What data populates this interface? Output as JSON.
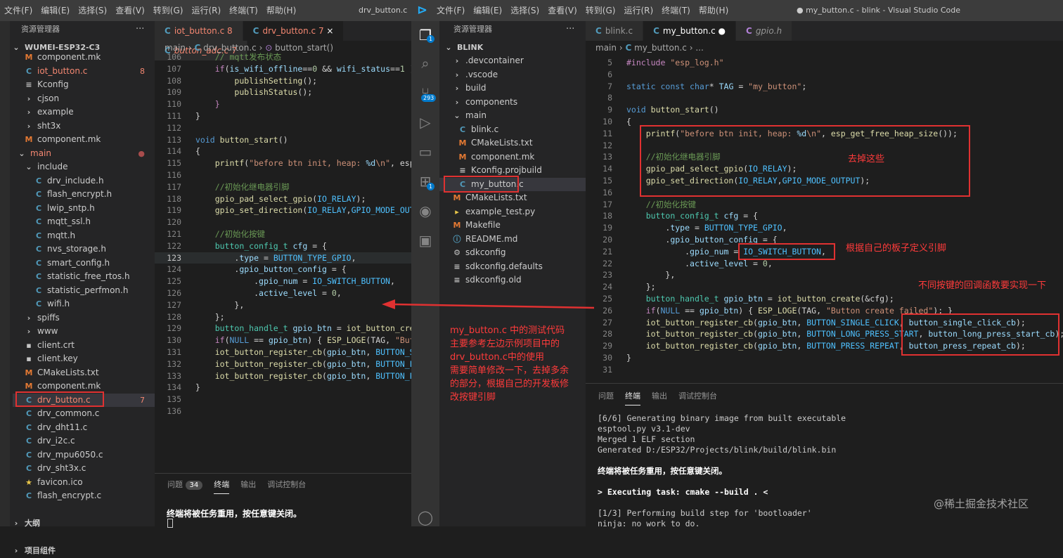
{
  "colors": {
    "accent": "#007acc",
    "annotation": "#ff3b3b",
    "c_icon": "#519aba",
    "m_icon": "#e37933",
    "error": "#f48771"
  },
  "left": {
    "menu": [
      "文件(F)",
      "编辑(E)",
      "选择(S)",
      "查看(V)",
      "转到(G)",
      "运行(R)",
      "终端(T)",
      "帮助(H)"
    ],
    "window_title": "drv_button.c - v",
    "explorer_title": "资源管理器",
    "dots": "···",
    "root": "WUMEI-ESP32-C3",
    "tree": [
      {
        "icon": "M",
        "label": "component.mk",
        "badge": ""
      },
      {
        "icon": "C",
        "label": "iot_button.c",
        "badge": "8",
        "error": true
      },
      {
        "icon": "≡",
        "label": "Kconfig",
        "badge": ""
      },
      {
        "icon": "›",
        "label": "cjson",
        "badge": ""
      },
      {
        "icon": "›",
        "label": "example",
        "badge": ""
      },
      {
        "icon": "›",
        "label": "sht3x",
        "badge": ""
      },
      {
        "icon": "M",
        "label": "component.mk",
        "badge": ""
      },
      {
        "icon": "⌄",
        "label": "main",
        "badge": "●",
        "error": true
      },
      {
        "icon": "⌄",
        "label": "include",
        "badge": ""
      },
      {
        "icon": "C",
        "label": "drv_include.h",
        "badge": ""
      },
      {
        "icon": "C",
        "label": "flash_encrypt.h",
        "badge": ""
      },
      {
        "icon": "C",
        "label": "lwip_sntp.h",
        "badge": ""
      },
      {
        "icon": "C",
        "label": "mqtt_ssl.h",
        "badge": ""
      },
      {
        "icon": "C",
        "label": "mqtt.h",
        "badge": ""
      },
      {
        "icon": "C",
        "label": "nvs_storage.h",
        "badge": ""
      },
      {
        "icon": "C",
        "label": "smart_config.h",
        "badge": ""
      },
      {
        "icon": "C",
        "label": "statistic_free_rtos.h",
        "badge": ""
      },
      {
        "icon": "C",
        "label": "statistic_perfmon.h",
        "badge": ""
      },
      {
        "icon": "C",
        "label": "wifi.h",
        "badge": ""
      },
      {
        "icon": "›",
        "label": "spiffs",
        "badge": ""
      },
      {
        "icon": "›",
        "label": "www",
        "badge": ""
      },
      {
        "icon": "▪",
        "label": "client.crt",
        "badge": ""
      },
      {
        "icon": "▪",
        "label": "client.key",
        "badge": ""
      },
      {
        "icon": "M",
        "label": "CMakeLists.txt",
        "badge": ""
      },
      {
        "icon": "M",
        "label": "component.mk",
        "badge": ""
      },
      {
        "icon": "C",
        "label": "drv_button.c",
        "badge": "7",
        "error": true,
        "selected": true
      },
      {
        "icon": "C",
        "label": "drv_common.c",
        "badge": ""
      },
      {
        "icon": "C",
        "label": "drv_dht11.c",
        "badge": ""
      },
      {
        "icon": "C",
        "label": "drv_i2c.c",
        "badge": ""
      },
      {
        "icon": "C",
        "label": "drv_mpu6050.c",
        "badge": ""
      },
      {
        "icon": "C",
        "label": "drv_sht3x.c",
        "badge": ""
      },
      {
        "icon": "★",
        "label": "favicon.ico",
        "badge": ""
      },
      {
        "icon": "C",
        "label": "flash_encrypt.c",
        "badge": ""
      }
    ],
    "outline": "大纲",
    "timeline": "项目组件",
    "tabs": [
      {
        "icon": "C",
        "label": "iot_button.c",
        "badge": "8"
      },
      {
        "icon": "C",
        "label": "drv_button.c",
        "badge": "7",
        "close": "×"
      },
      {
        "icon": "C",
        "label": "button_adc.c",
        "badge": "7"
      }
    ],
    "crumbs": [
      "main",
      "›",
      "drv_button.c",
      "›",
      "button_start()"
    ],
    "panel_tabs": [
      "问题",
      "终端",
      "输出",
      "调试控制台"
    ],
    "problems_count": "34",
    "terminal_line": "终端将被任务重用，按任意键关闭。",
    "line_numbers": [
      "106",
      "107",
      "108",
      "109",
      "110",
      "111",
      "112",
      "113",
      "114",
      "115",
      "116",
      "117",
      "118",
      "119",
      "120",
      "121",
      "122",
      "123",
      "124",
      "125",
      "126",
      "127",
      "128",
      "129",
      "130",
      "131",
      "132",
      "133",
      "134",
      "135",
      "136"
    ]
  },
  "right": {
    "menu": [
      "文件(F)",
      "编辑(E)",
      "选择(S)",
      "查看(V)",
      "转到(G)",
      "运行(R)",
      "终端(T)",
      "帮助(H)"
    ],
    "window_title": "● my_button.c - blink - Visual Studio Code",
    "explorer_title": "资源管理器",
    "dots": "···",
    "root": "BLINK",
    "scm_badge": "293",
    "ext_badge": "1",
    "tree": [
      {
        "icon": "›",
        "label": ".devcontainer"
      },
      {
        "icon": "›",
        "label": ".vscode"
      },
      {
        "icon": "›",
        "label": "build"
      },
      {
        "icon": "›",
        "label": "components"
      },
      {
        "icon": "⌄",
        "label": "main"
      },
      {
        "icon": "C",
        "label": "blink.c"
      },
      {
        "icon": "M",
        "label": "CMakeLists.txt"
      },
      {
        "icon": "M",
        "label": "component.mk"
      },
      {
        "icon": "≡",
        "label": "Kconfig.projbuild"
      },
      {
        "icon": "C",
        "label": "my_button.c",
        "selected": true
      },
      {
        "icon": "M",
        "label": "CMakeLists.txt"
      },
      {
        "icon": "▸",
        "label": "example_test.py"
      },
      {
        "icon": "M",
        "label": "Makefile"
      },
      {
        "icon": "ⓘ",
        "label": "README.md"
      },
      {
        "icon": "⚙",
        "label": "sdkconfig"
      },
      {
        "icon": "≡",
        "label": "sdkconfig.defaults"
      },
      {
        "icon": "≡",
        "label": "sdkconfig.old"
      }
    ],
    "tabs": [
      {
        "icon": "C",
        "label": "blink.c"
      },
      {
        "icon": "C",
        "label": "my_button.c",
        "dirty": "●"
      },
      {
        "icon": "C",
        "label": "gpio.h"
      }
    ],
    "crumbs": [
      "main",
      "›",
      "my_button.c",
      "›",
      "..."
    ],
    "panel_tabs": [
      "问题",
      "终端",
      "输出",
      "调试控制台"
    ],
    "terminal": [
      "[6/6] Generating binary image from built executable",
      "esptool.py v3.1-dev",
      "Merged 1 ELF section",
      "Generated D:/ESP32/Projects/blink/build/blink.bin",
      "",
      "终端将被任务重用，按任意键关闭。",
      "",
      "> Executing task: cmake --build . <",
      "",
      "[1/3] Performing build step for 'bootloader'",
      "ninja: no work to do."
    ],
    "line_numbers": [
      "5",
      "6",
      "7",
      "8",
      "9",
      "10",
      "11",
      "12",
      "13",
      "14",
      "15",
      "16",
      "17",
      "18",
      "19",
      "20",
      "21",
      "22",
      "23",
      "24",
      "25",
      "26",
      "27",
      "28",
      "29",
      "30",
      "31"
    ]
  },
  "annotations": {
    "remove": "去掉这些",
    "define_pin": "根据自己的板子定义引脚",
    "callbacks": "不同按键的回调函数要实现一下",
    "middle": [
      "my_button.c 中的测试代码",
      "主要参考左边示例项目中的",
      "drv_button.c中的使用",
      "需要简单修改一下，去掉多余",
      "的部分，根据自己的开发板修",
      "改按键引脚"
    ]
  },
  "watermark": "@稀土掘金技术社区"
}
